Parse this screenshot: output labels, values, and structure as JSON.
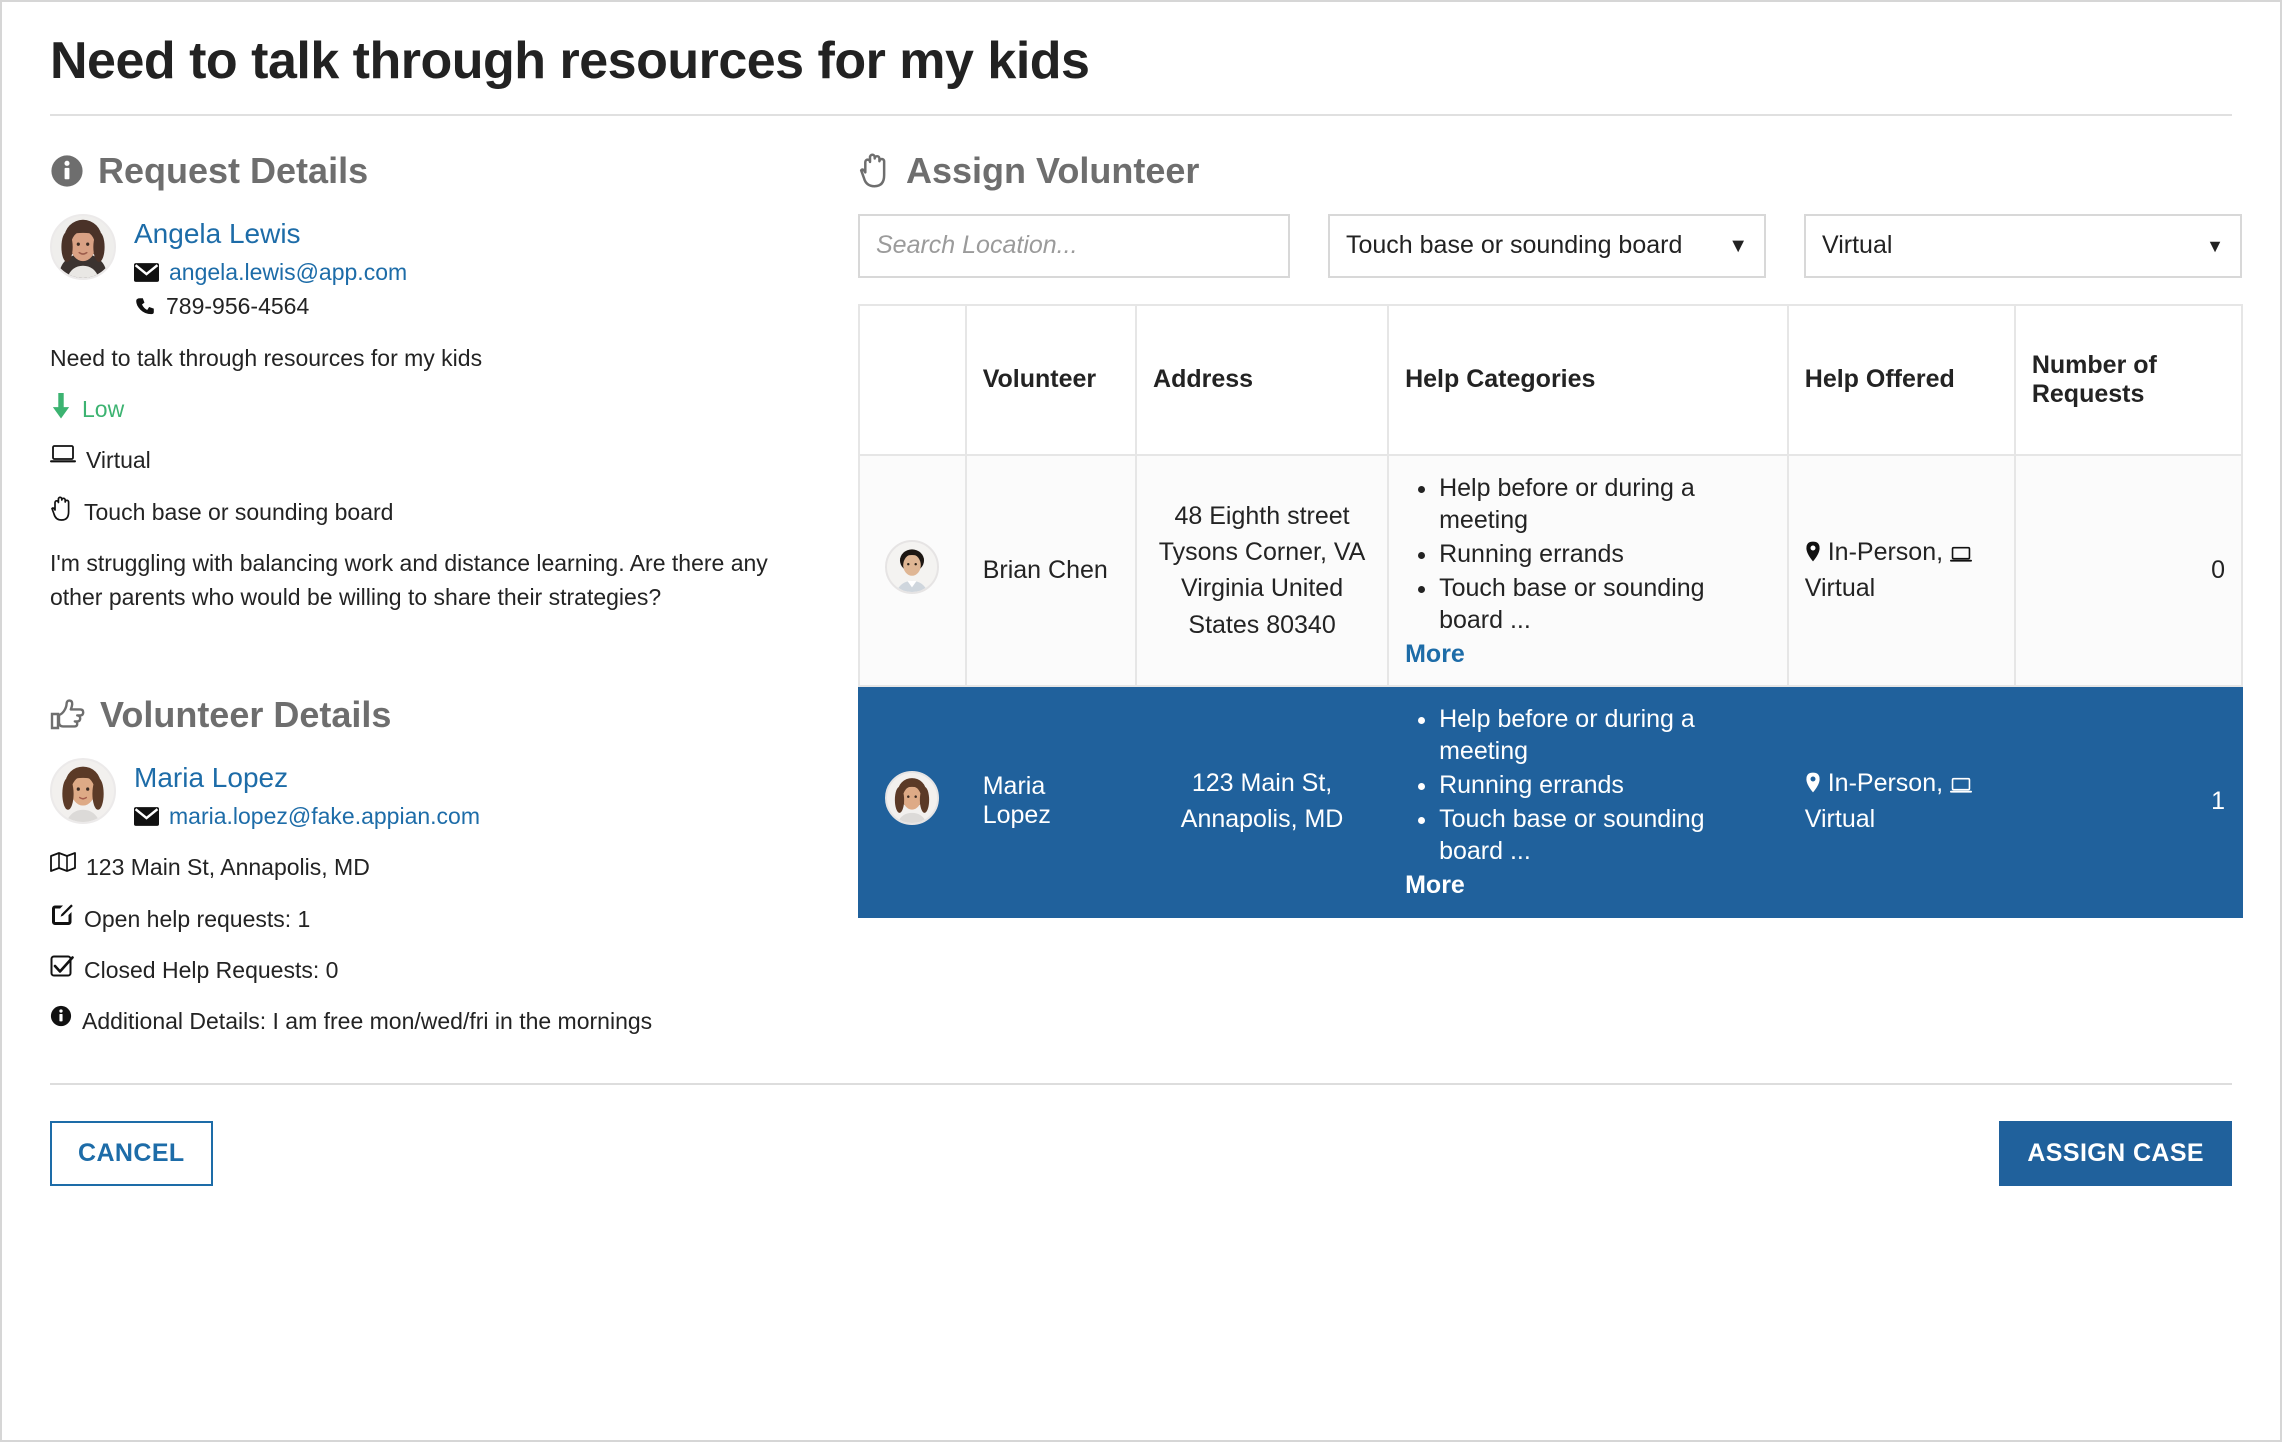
{
  "page": {
    "title": "Need to talk through resources for my kids"
  },
  "request_details": {
    "heading": "Request Details",
    "heading_icon": "info-circle-icon",
    "requester": {
      "name": "Angela Lewis",
      "email": "angela.lewis@app.com",
      "phone": "789-956-4564",
      "email_icon": "envelope-icon",
      "phone_icon": "phone-icon",
      "avatar_icon": "avatar-angela-lewis"
    },
    "summary": "Need to talk through resources for my kids",
    "priority": "Low",
    "priority_icon": "arrow-down-icon",
    "priority_color": "#3cb371",
    "mode": "Virtual",
    "mode_icon": "laptop-icon",
    "category": "Touch base or sounding board",
    "category_icon": "hand-icon",
    "description": " I'm struggling with balancing work and distance learning. Are there any other parents who would be willing to share their strategies?"
  },
  "volunteer_details": {
    "heading": "Volunteer Details",
    "heading_icon": "thumbs-up-icon",
    "volunteer": {
      "name": "Maria Lopez",
      "email": "maria.lopez@fake.appian.com",
      "email_icon": "envelope-icon",
      "avatar_icon": "avatar-maria-lopez"
    },
    "address": "123 Main St, Annapolis, MD",
    "address_icon": "map-icon",
    "open_requests": "Open help requests: 1",
    "open_requests_icon": "edit-icon",
    "closed_requests": "Closed Help Requests: 0",
    "closed_requests_icon": "check-square-icon",
    "additional_details": "Additional Details: I am free mon/wed/fri in the mornings",
    "additional_details_icon": "info-circle-icon"
  },
  "assign_volunteer": {
    "heading": "Assign Volunteer",
    "heading_icon": "hand-icon",
    "filters": {
      "search_placeholder": "Search Location...",
      "search_value": "",
      "search_icon": "search-input",
      "category_select_value": "Touch base or sounding board",
      "mode_select_value": "Virtual",
      "caret_icon": "chevron-down-icon"
    },
    "table": {
      "columns": [
        {
          "key": "avatar",
          "label": ""
        },
        {
          "key": "volunteer",
          "label": "Volunteer"
        },
        {
          "key": "address",
          "label": "Address"
        },
        {
          "key": "categories",
          "label": "Help Categories"
        },
        {
          "key": "offered",
          "label": "Help Offered"
        },
        {
          "key": "requests",
          "label": "Number of Requests"
        }
      ],
      "rows": [
        {
          "selected": false,
          "avatar_icon": "avatar-brian-chen",
          "volunteer": "Brian Chen",
          "address": " 48 Eighth  street Tysons Corner, VA Virginia United States 80340",
          "categories": [
            "Help before or during a meeting",
            "Running errands",
            "Touch base or sounding board ..."
          ],
          "more_label": "More",
          "offered": "In-Person,  Virtual",
          "offered_location_icon": "map-pin-icon",
          "offered_virtual_icon": "laptop-icon",
          "requests": "0"
        },
        {
          "selected": true,
          "avatar_icon": "avatar-maria-lopez",
          "volunteer": "Maria Lopez",
          "address": "123 Main St, Annapolis, MD",
          "categories": [
            "Help before or during a meeting",
            "Running errands",
            "Touch base or sounding board ..."
          ],
          "more_label": "More",
          "offered": "In-Person,  Virtual",
          "offered_location_icon": "map-pin-icon",
          "offered_virtual_icon": "laptop-icon",
          "requests": "1"
        }
      ]
    }
  },
  "footer": {
    "cancel_label": "CANCEL",
    "assign_label": "ASSIGN CASE"
  },
  "colors": {
    "accent_blue": "#20619c",
    "link_blue": "#1d6ca8",
    "low_green": "#3cb371",
    "heading_gray": "#6e6e6e"
  }
}
